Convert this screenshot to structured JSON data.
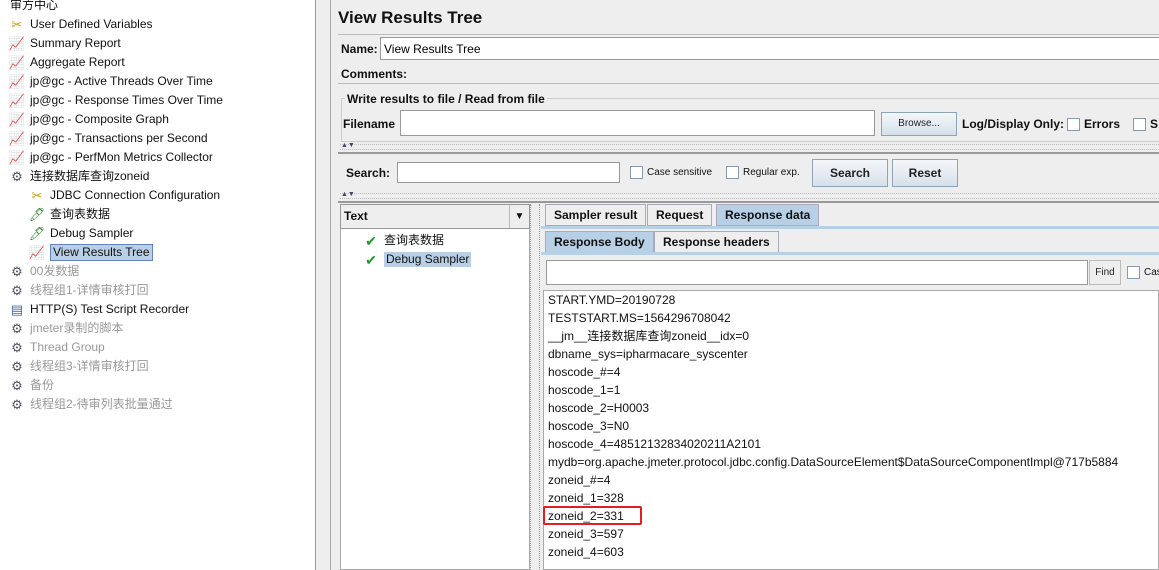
{
  "tree": {
    "items": [
      {
        "label": "审方中心",
        "icon": "gear-icon",
        "indent": 0,
        "disabled": false
      },
      {
        "label": "User Defined Variables",
        "icon": "wrench-scissors-icon",
        "indent": 1,
        "disabled": false
      },
      {
        "label": "Summary Report",
        "icon": "graph-icon",
        "indent": 1,
        "disabled": false
      },
      {
        "label": "Aggregate Report",
        "icon": "graph-icon",
        "indent": 1,
        "disabled": false
      },
      {
        "label": "jp@gc - Active Threads Over Time",
        "icon": "graph-icon",
        "indent": 1,
        "disabled": false
      },
      {
        "label": "jp@gc - Response Times Over Time",
        "icon": "graph-icon",
        "indent": 1,
        "disabled": false
      },
      {
        "label": "jp@gc - Composite Graph",
        "icon": "graph-icon",
        "indent": 1,
        "disabled": false
      },
      {
        "label": "jp@gc - Transactions per Second",
        "icon": "graph-icon",
        "indent": 1,
        "disabled": false
      },
      {
        "label": "jp@gc - PerfMon Metrics Collector",
        "icon": "graph-icon",
        "indent": 1,
        "disabled": false
      },
      {
        "label": "连接数据库查询zoneid",
        "icon": "gear-icon",
        "indent": 1,
        "disabled": false
      },
      {
        "label": "JDBC Connection Configuration",
        "icon": "wrench-scissors-icon",
        "indent": 2,
        "disabled": false
      },
      {
        "label": "查询表数据",
        "icon": "pipette-icon",
        "indent": 2,
        "disabled": false
      },
      {
        "label": "Debug Sampler",
        "icon": "pipette-icon",
        "indent": 2,
        "disabled": false
      },
      {
        "label": "View Results Tree",
        "icon": "graph-icon",
        "indent": 2,
        "disabled": false,
        "selected": true
      },
      {
        "label": "00发数据",
        "icon": "gear-icon",
        "indent": 1,
        "disabled": true
      },
      {
        "label": "线程组1-详情审核打回",
        "icon": "gear-icon",
        "indent": 1,
        "disabled": true
      },
      {
        "label": "HTTP(S) Test Script Recorder",
        "icon": "recorder-icon",
        "indent": 1,
        "disabled": false
      },
      {
        "label": "jmeter录制的脚本",
        "icon": "gear-icon",
        "indent": 1,
        "disabled": true
      },
      {
        "label": "Thread Group",
        "icon": "gear-icon",
        "indent": 1,
        "disabled": true
      },
      {
        "label": "线程组3-详情审核打回",
        "icon": "gear-icon",
        "indent": 1,
        "disabled": true
      },
      {
        "label": "备份",
        "icon": "gear-icon",
        "indent": 1,
        "disabled": true
      },
      {
        "label": "线程组2-待审列表批量通过",
        "icon": "gear-icon",
        "indent": 1,
        "disabled": true
      }
    ]
  },
  "panel": {
    "title": "View Results Tree",
    "name_label": "Name:",
    "name_value": "View Results Tree",
    "comments_label": "Comments:",
    "file_group_title": "Write results to file / Read from file",
    "filename_label": "Filename",
    "filename_value": "",
    "browse_label": "Browse...",
    "log_display_label": "Log/Display Only:",
    "errors_label": "Errors",
    "successes_label_partial": "S",
    "search_label": "Search:",
    "search_value": "",
    "case_sensitive_label": "Case sensitive",
    "regex_label": "Regular exp.",
    "search_button": "Search",
    "reset_button": "Reset"
  },
  "results": {
    "renderer": "Text",
    "samples": [
      {
        "label": "查询表数据",
        "status": "success"
      },
      {
        "label": "Debug Sampler",
        "status": "success",
        "selected": true
      }
    ],
    "tabs": [
      "Sampler result",
      "Request",
      "Response data"
    ],
    "active_tab": "Response data",
    "subtabs": [
      "Response Body",
      "Response headers"
    ],
    "active_subtab": "Response Body",
    "find_value": "",
    "find_button": "Find",
    "case_partial": "Cas",
    "lines": [
      "START.YMD=20190728",
      "TESTSTART.MS=1564296708042",
      "__jm__连接数据库查询zoneid__idx=0",
      "dbname_sys=ipharmacare_syscenter",
      "hoscode_#=4",
      "hoscode_1=1",
      "hoscode_2=H0003",
      "hoscode_3=N0",
      "hoscode_4=48512132834020211A2101",
      "mydb=org.apache.jmeter.protocol.jdbc.config.DataSourceElement$DataSourceComponentImpl@717b5884",
      "zoneid_#=4",
      "zoneid_1=328",
      "zoneid_2=331",
      "zoneid_3=597",
      "zoneid_4=603"
    ],
    "highlighted_line": "zoneid_2=331",
    "highlight_color": "#e02020"
  }
}
